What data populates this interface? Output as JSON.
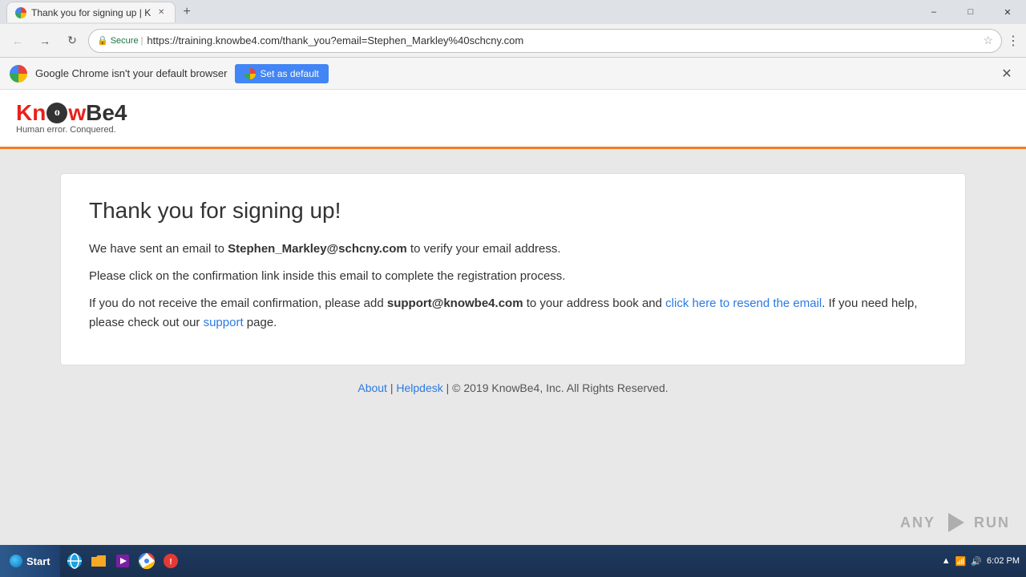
{
  "browser": {
    "tab_title": "Thank you for signing up | K",
    "url": "https://training.knowbe4.com/thank_you?email=Stephen_Markley%40schcny.com",
    "secure_label": "Secure",
    "notification_text": "Google Chrome isn't your default browser",
    "set_default_label": "Set as default"
  },
  "header": {
    "logo_know": "Know",
    "logo_be": "Be4",
    "tagline": "Human error. Conquered."
  },
  "content": {
    "heading": "Thank you for signing up!",
    "line1_prefix": "We have sent an email to ",
    "line1_email": "Stephen_Markley@schcny.com",
    "line1_suffix": " to verify your email address.",
    "line2": "Please click on the confirmation link inside this email to complete the registration process.",
    "line3_prefix": "If you do not receive the email confirmation, please add ",
    "line3_support_email": "support@knowbe4.com",
    "line3_middle": " to your address book and ",
    "line3_resend_link": "click here to resend the email",
    "line3_suffix": ". If you need help, please check out our ",
    "line3_support_link": "support",
    "line3_end": " page."
  },
  "footer": {
    "about_label": "About",
    "helpdesk_label": "Helpdesk",
    "copyright": "© 2019 KnowBe4, Inc. All Rights Reserved."
  },
  "taskbar": {
    "start_label": "Start",
    "time": "6:02 PM"
  }
}
